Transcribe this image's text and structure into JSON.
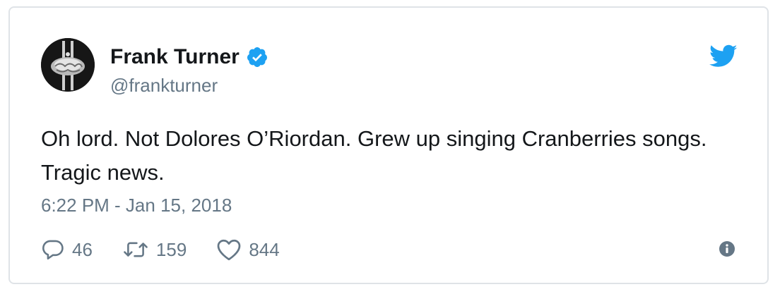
{
  "tweet": {
    "author": {
      "display_name": "Frank Turner",
      "handle": "@frankturner",
      "verified": true,
      "avatar_icon": "clasped-hands-avatar"
    },
    "text": "Oh lord. Not Dolores O’Riordan. Grew up singing Cranberries songs. Tragic news.",
    "timestamp": "6:22 PM - Jan 15, 2018",
    "actions": {
      "replies": {
        "icon": "reply-icon",
        "count": "46"
      },
      "retweets": {
        "icon": "retweet-icon",
        "count": "159"
      },
      "likes": {
        "icon": "heart-icon",
        "count": "844"
      }
    },
    "colors": {
      "brand_blue": "#1da1f2",
      "muted_text": "#657786",
      "body_text": "#14171a",
      "border": "#dfe3e7"
    }
  }
}
